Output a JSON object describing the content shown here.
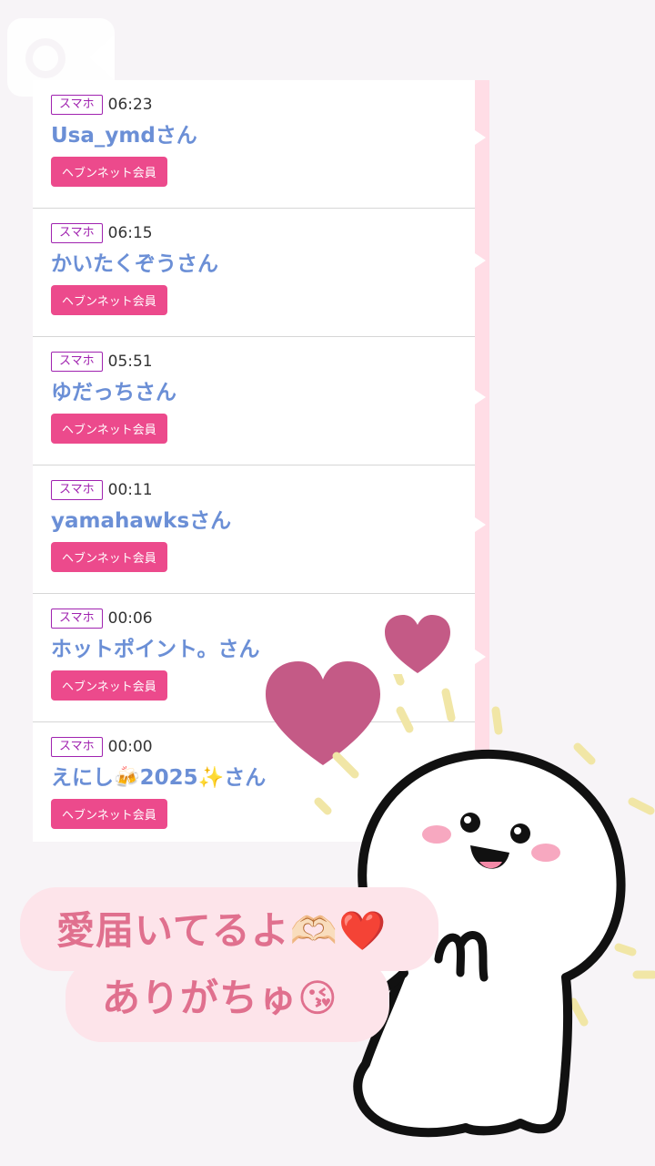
{
  "feed": {
    "entries": [
      {
        "device": "スマホ",
        "time": "06:23",
        "name": "Usa_ymdさん",
        "badge": "ヘブンネット会員"
      },
      {
        "device": "スマホ",
        "time": "06:15",
        "name": "かいたくぞうさん",
        "badge": "ヘブンネット会員"
      },
      {
        "device": "スマホ",
        "time": "05:51",
        "name": "ゆだっちさん",
        "badge": "ヘブンネット会員"
      },
      {
        "device": "スマホ",
        "time": "00:11",
        "name": "yamahawksさん",
        "badge": "ヘブンネット会員"
      },
      {
        "device": "スマホ",
        "time": "00:06",
        "name": "ホットポイント。さん",
        "badge": "ヘブンネット会員"
      },
      {
        "device": "スマホ",
        "time": "00:00",
        "name": "えにし🍻2025✨さん",
        "badge": "ヘブンネット会員"
      }
    ]
  },
  "message": {
    "line1": "愛届いてるよ🫶🏻❤️",
    "line2": "ありがちゅ😘"
  },
  "icons": {
    "video": "video-camera-icon",
    "hearts": "heart-icon",
    "mascot": "mascot-character"
  },
  "colors": {
    "badge": "#ec4a8c",
    "device_tag": "#a023b0",
    "visitor_name": "#6b8fd6",
    "message_text": "#e0708e",
    "heart": "#c45a86"
  }
}
